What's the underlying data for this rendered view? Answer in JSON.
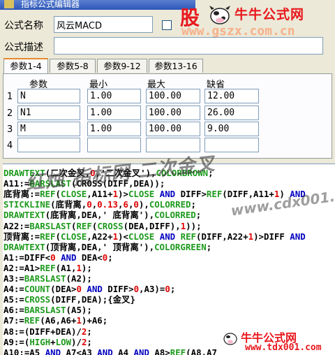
{
  "window": {
    "title": "指标公式编辑器"
  },
  "form": {
    "name_label": "公式名称",
    "name_value": "风云MACD",
    "desc_label": "公式描述",
    "desc_value": ""
  },
  "tabs": [
    "参数1-4",
    "参数5-8",
    "参数9-12",
    "参数13-16"
  ],
  "params": {
    "headers": [
      "参数",
      "最小",
      "最大",
      "缺省"
    ],
    "rows": [
      {
        "num": "1",
        "name": "N",
        "min": "1.00",
        "max": "100.00",
        "default": "12.00"
      },
      {
        "num": "2",
        "name": "N1",
        "min": "1.00",
        "max": "100.00",
        "default": "26.00"
      },
      {
        "num": "3",
        "name": "M",
        "min": "1.00",
        "max": "100.00",
        "default": "9.00"
      },
      {
        "num": "4",
        "name": "",
        "min": "",
        "max": "",
        "default": ""
      }
    ]
  },
  "watermarks": {
    "top_gu": "股",
    "top_brand": "牛牛公式网",
    "top_url": "www.gszx.com.cn",
    "mid_text": "红烛 指标网 二次金叉",
    "mid_url": "www.cdx001.com",
    "bottom_brand": "牛牛公式网",
    "bottom_url": "www.tdx001.com"
  },
  "code_lines": [
    [
      [
        "kw",
        "DRAWTEXT"
      ],
      [
        "tx",
        "(二次金叉,"
      ],
      [
        "num",
        "0"
      ],
      [
        "tx",
        ",'二次金叉'),"
      ],
      [
        "kw",
        "COLORBROWN"
      ],
      [
        "tx",
        ";"
      ]
    ],
    [
      [
        "tx",
        "A11:="
      ],
      [
        "kw",
        "BARSLAST"
      ],
      [
        "tx",
        "(CROSS(DIFF,DEA));"
      ]
    ],
    [
      [
        "tx",
        "底背离:="
      ],
      [
        "kw",
        "REF"
      ],
      [
        "tx",
        "("
      ],
      [
        "kw",
        "CLOSE"
      ],
      [
        "tx",
        ",A11+"
      ],
      [
        "num",
        "1"
      ],
      [
        "tx",
        ")>"
      ],
      [
        "kw",
        "CLOSE"
      ],
      [
        "tx",
        " "
      ],
      [
        "op",
        "AND"
      ],
      [
        "tx",
        " DIFF>"
      ],
      [
        "kw",
        "REF"
      ],
      [
        "tx",
        "(DIFF,A11+"
      ],
      [
        "num",
        "1"
      ],
      [
        "tx",
        ") "
      ],
      [
        "op",
        "AND"
      ]
    ],
    [
      [
        "kw",
        "STICKLINE"
      ],
      [
        "tx",
        "(底背离,"
      ],
      [
        "num",
        "0"
      ],
      [
        "tx",
        ","
      ],
      [
        "num",
        "0.13"
      ],
      [
        "tx",
        ","
      ],
      [
        "num",
        "6"
      ],
      [
        "tx",
        ","
      ],
      [
        "num",
        "0"
      ],
      [
        "tx",
        "),"
      ],
      [
        "kw",
        "COLORRED"
      ],
      [
        "tx",
        ";"
      ]
    ],
    [
      [
        "kw",
        "DRAWTEXT"
      ],
      [
        "tx",
        "(底背离,DEA,' 底背离'),"
      ],
      [
        "kw",
        "COLORRED"
      ],
      [
        "tx",
        ";"
      ]
    ],
    [
      [
        "tx",
        "A22:="
      ],
      [
        "kw",
        "BARSLAST"
      ],
      [
        "tx",
        "("
      ],
      [
        "kw",
        "REF"
      ],
      [
        "tx",
        "("
      ],
      [
        "kw",
        "CROSS"
      ],
      [
        "tx",
        "(DEA,DIFF),"
      ],
      [
        "num",
        "1"
      ],
      [
        "tx",
        "));"
      ]
    ],
    [
      [
        "tx",
        "顶背离:="
      ],
      [
        "kw",
        "REF"
      ],
      [
        "tx",
        "("
      ],
      [
        "kw",
        "CLOSE"
      ],
      [
        "tx",
        ",A22+"
      ],
      [
        "num",
        "1"
      ],
      [
        "tx",
        ")<"
      ],
      [
        "kw",
        "CLOSE"
      ],
      [
        "tx",
        " "
      ],
      [
        "op",
        "AND"
      ],
      [
        "tx",
        " "
      ],
      [
        "kw",
        "REF"
      ],
      [
        "tx",
        "(DIFF,A22+"
      ],
      [
        "num",
        "1"
      ],
      [
        "tx",
        ")>DIFF "
      ],
      [
        "op",
        "AND"
      ]
    ],
    [
      [
        "kw",
        "DRAWTEXT"
      ],
      [
        "tx",
        "(顶背离,DEA,' 顶背离'),"
      ],
      [
        "kw",
        "COLORGREEN"
      ],
      [
        "tx",
        ";"
      ]
    ],
    [
      [
        "tx",
        "A1:=DIFF<"
      ],
      [
        "num",
        "0"
      ],
      [
        "tx",
        " "
      ],
      [
        "op",
        "AND"
      ],
      [
        "tx",
        " DEA<"
      ],
      [
        "num",
        "0"
      ],
      [
        "tx",
        ";"
      ]
    ],
    [
      [
        "tx",
        "A2:=A1>"
      ],
      [
        "kw",
        "REF"
      ],
      [
        "tx",
        "(A1,"
      ],
      [
        "num",
        "1"
      ],
      [
        "tx",
        ");"
      ]
    ],
    [
      [
        "tx",
        "A3:="
      ],
      [
        "kw",
        "BARSLAST"
      ],
      [
        "tx",
        "(A2);"
      ]
    ],
    [
      [
        "tx",
        "A4:="
      ],
      [
        "kw",
        "COUNT"
      ],
      [
        "tx",
        "(DEA>"
      ],
      [
        "num",
        "0"
      ],
      [
        "tx",
        " "
      ],
      [
        "op",
        "AND"
      ],
      [
        "tx",
        " DIFF>"
      ],
      [
        "num",
        "0"
      ],
      [
        "tx",
        ",A3)="
      ],
      [
        "num",
        "0"
      ],
      [
        "tx",
        ";"
      ]
    ],
    [
      [
        "tx",
        "A5:="
      ],
      [
        "kw",
        "CROSS"
      ],
      [
        "tx",
        "(DIFF,DEA);{金叉}"
      ]
    ],
    [
      [
        "tx",
        "A6:="
      ],
      [
        "kw",
        "BARSLAST"
      ],
      [
        "tx",
        "(A5);"
      ]
    ],
    [
      [
        "tx",
        "A7:="
      ],
      [
        "kw",
        "REF"
      ],
      [
        "tx",
        "(A6,A6+"
      ],
      [
        "num",
        "1"
      ],
      [
        "tx",
        ")+A6;"
      ]
    ],
    [
      [
        "tx",
        "A8:=(DIFF+DEA)/"
      ],
      [
        "num",
        "2"
      ],
      [
        "tx",
        ";"
      ]
    ],
    [
      [
        "tx",
        "A9:=("
      ],
      [
        "kw",
        "HIGH"
      ],
      [
        "tx",
        "+"
      ],
      [
        "kw",
        "LOW"
      ],
      [
        "tx",
        ")/"
      ],
      [
        "num",
        "2"
      ],
      [
        "tx",
        ";"
      ]
    ],
    [
      [
        "tx",
        "A10:=A5 "
      ],
      [
        "op",
        "AND"
      ],
      [
        "tx",
        " A7<A3 "
      ],
      [
        "op",
        "AND"
      ],
      [
        "tx",
        " A4 "
      ],
      [
        "op",
        "AND"
      ],
      [
        "tx",
        " A8>"
      ],
      [
        "kw",
        "REF"
      ],
      [
        "tx",
        "(A8,A7"
      ]
    ]
  ]
}
